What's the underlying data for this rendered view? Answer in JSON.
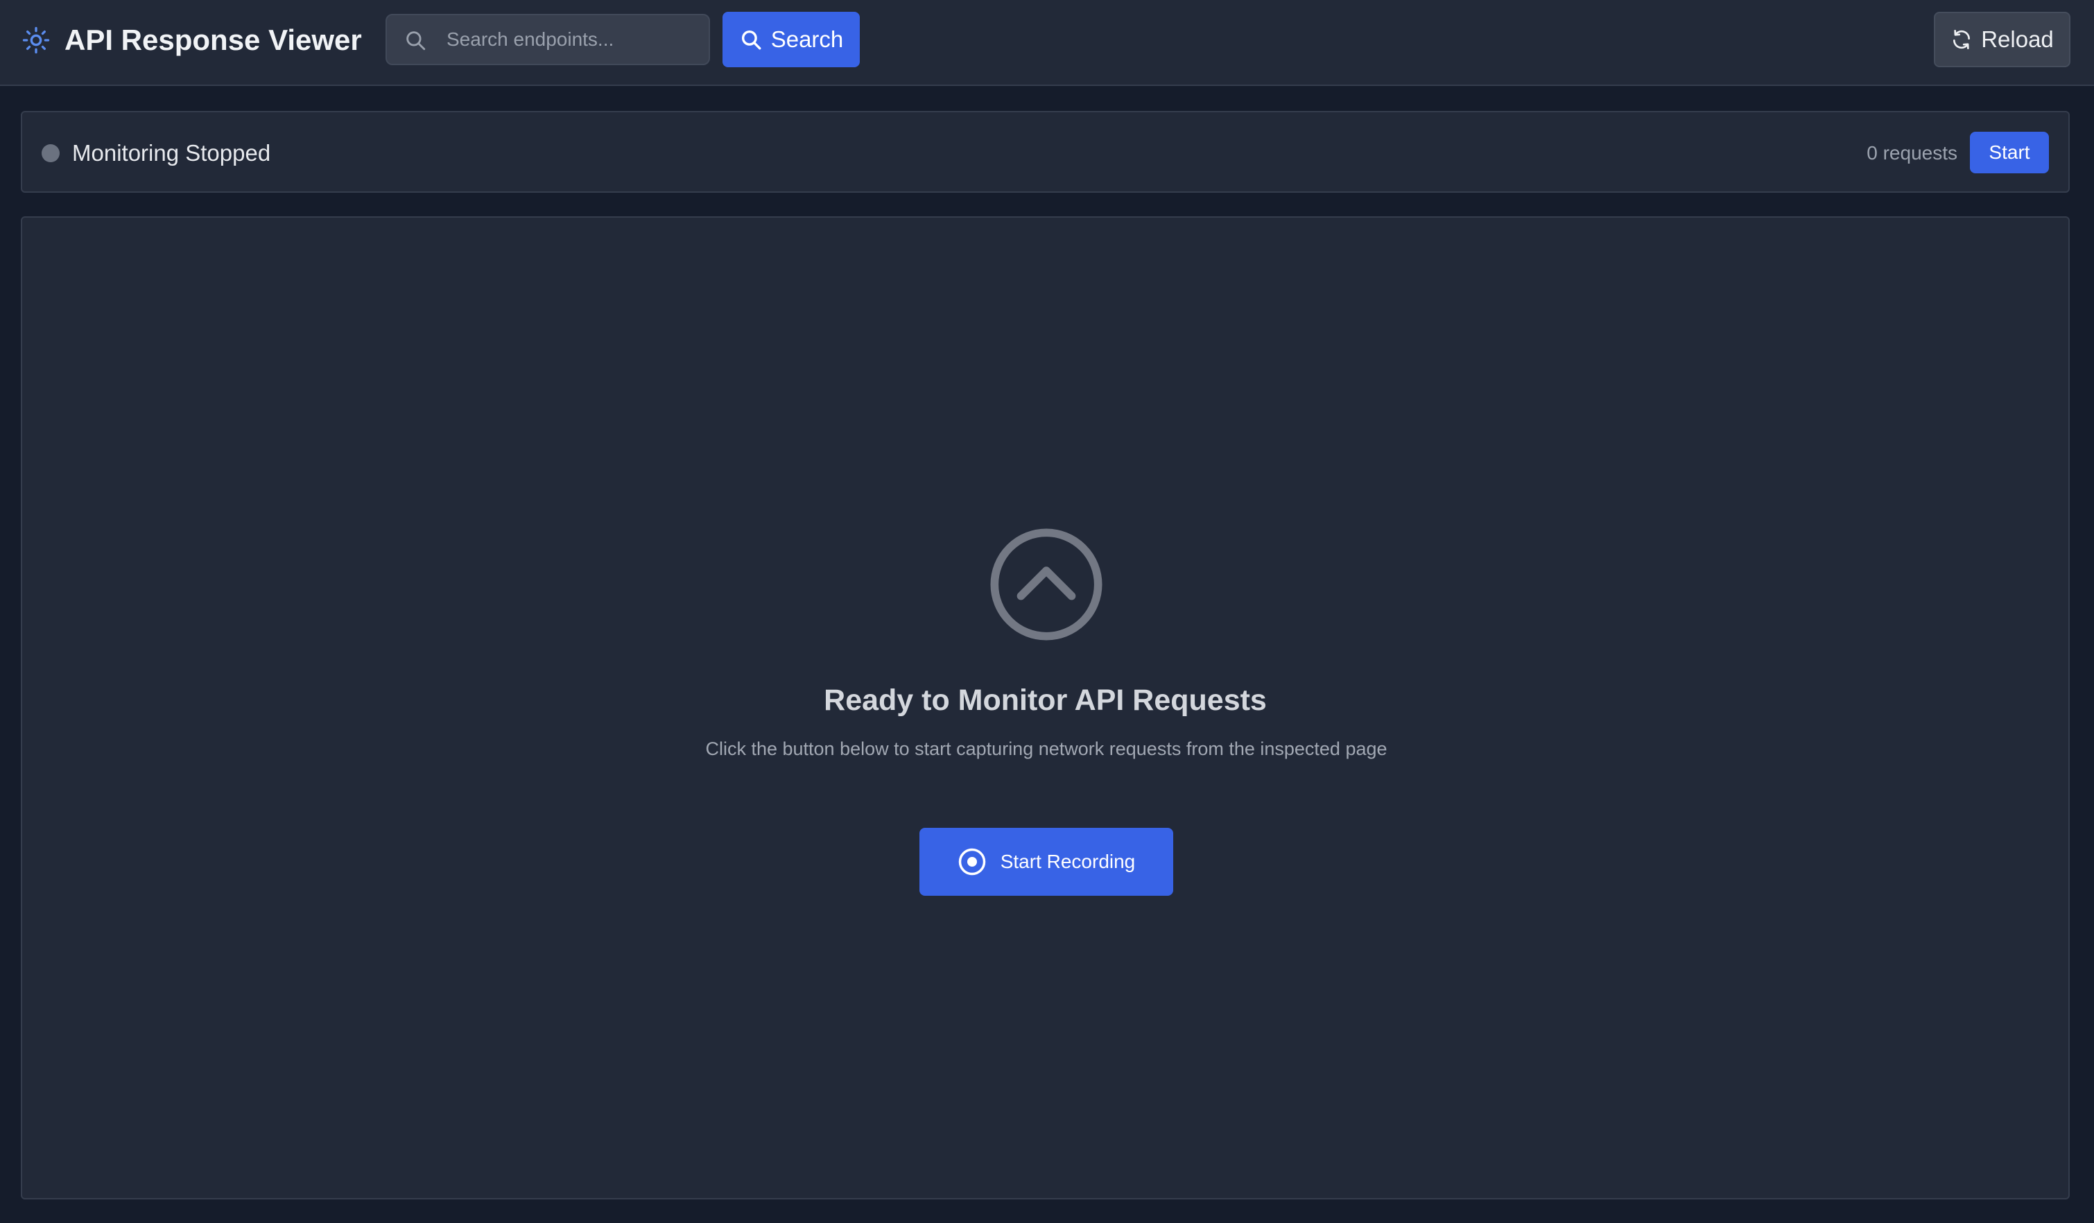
{
  "header": {
    "title": "API Response Viewer",
    "logo_icon": "sun-icon",
    "search": {
      "placeholder": "Search endpoints...",
      "value": "",
      "button_label": "Search"
    },
    "reload_label": "Reload"
  },
  "status": {
    "text": "Monitoring Stopped",
    "dot_color": "#6b7280",
    "request_count": "0 requests",
    "start_label": "Start"
  },
  "empty_state": {
    "icon": "chevron-up-circle-icon",
    "title": "Ready to Monitor API Requests",
    "description": "Click the button below to start capturing network requests from the inspected page",
    "button_label": "Start Recording",
    "button_icon": "record-icon"
  },
  "colors": {
    "accent": "#3863e6",
    "background": "#151c2b",
    "panel": "#222938"
  }
}
